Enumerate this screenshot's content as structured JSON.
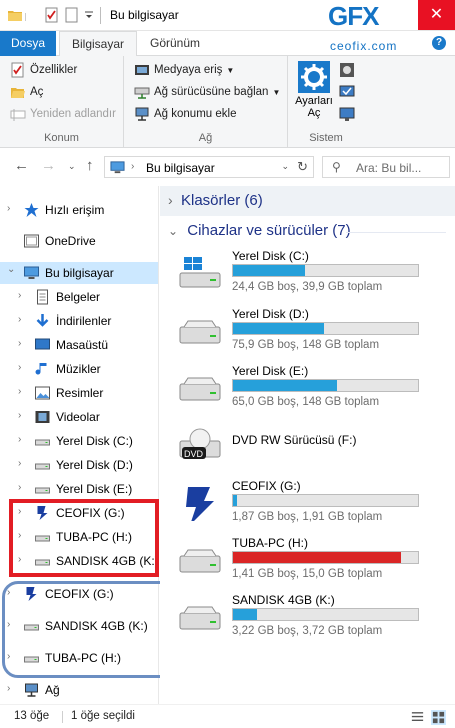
{
  "window": {
    "title": "Bu bilgisayar",
    "logo_text": "GFX",
    "close_glyph": "✕"
  },
  "ribbon": {
    "tabs": [
      {
        "label": "Dosya"
      },
      {
        "label": "Bilgisayar"
      },
      {
        "label": "Görünüm"
      }
    ],
    "watermark": "ceofix.com",
    "help": "?",
    "groups": {
      "konum": {
        "label": "Konum",
        "items": [
          "Özellikler",
          "Aç",
          "Yeniden adlandır"
        ]
      },
      "ag": {
        "label": "Ağ",
        "items": [
          "Medyaya eriş",
          "Ağ sürücüsüne bağlan",
          "Ağ konumu ekle"
        ]
      },
      "sistem": {
        "label": "Sistem",
        "open_settings": "Ayarları Aç"
      }
    }
  },
  "address": {
    "location": "Bu bilgisayar",
    "search_placeholder": "Ara: Bu bil..."
  },
  "nav": {
    "items": [
      {
        "label": "Hızlı erişim",
        "icon": "star-icon"
      },
      {
        "label": "OneDrive",
        "icon": "onedrive-icon"
      },
      {
        "label": "Bu bilgisayar",
        "icon": "computer-icon"
      },
      {
        "label": "Belgeler",
        "icon": "documents-icon"
      },
      {
        "label": "İndirilenler",
        "icon": "downloads-icon"
      },
      {
        "label": "Masaüstü",
        "icon": "desktop-icon"
      },
      {
        "label": "Müzikler",
        "icon": "music-icon"
      },
      {
        "label": "Resimler",
        "icon": "pictures-icon"
      },
      {
        "label": "Videolar",
        "icon": "videos-icon"
      },
      {
        "label": "Yerel Disk (C:)",
        "icon": "drive-icon"
      },
      {
        "label": "Yerel Disk (D:)",
        "icon": "drive-icon"
      },
      {
        "label": "Yerel Disk (E:)",
        "icon": "drive-icon"
      },
      {
        "label": "CEOFIX (G:)",
        "icon": "custom-drive-icon"
      },
      {
        "label": "TUBA-PC (H:)",
        "icon": "drive-icon"
      },
      {
        "label": "SANDISK 4GB (K:)",
        "icon": "drive-icon"
      },
      {
        "label": "CEOFIX (G:)",
        "icon": "custom-drive-icon"
      },
      {
        "label": "SANDISK 4GB (K:)",
        "icon": "drive-icon"
      },
      {
        "label": "TUBA-PC (H:)",
        "icon": "drive-icon"
      },
      {
        "label": "Ağ",
        "icon": "network-icon"
      }
    ]
  },
  "content": {
    "folders_header": "Klasörler (6)",
    "devices_header": "Cihazlar ve sürücüler (7)",
    "drives": [
      {
        "name": "Yerel Disk (C:)",
        "info": "24,4 GB boş, 39,9 GB toplam",
        "used_fraction": 0.39,
        "icon": "windows-drive-icon"
      },
      {
        "name": "Yerel Disk (D:)",
        "info": "75,9 GB boş, 148 GB toplam",
        "used_fraction": 0.49,
        "icon": "drive-icon"
      },
      {
        "name": "Yerel Disk (E:)",
        "info": "65,0 GB boş, 148 GB toplam",
        "used_fraction": 0.56,
        "icon": "drive-icon"
      },
      {
        "name": "DVD RW Sürücüsü (F:)",
        "info": "",
        "used_fraction": null,
        "icon": "dvd-drive-icon",
        "icon_text": "DVD"
      },
      {
        "name": "CEOFIX (G:)",
        "info": "1,87 GB boş, 1,91 GB toplam",
        "used_fraction": 0.02,
        "icon": "custom-drive-icon"
      },
      {
        "name": "TUBA-PC (H:)",
        "info": "1,41 GB boş, 15,0 GB toplam",
        "used_fraction": 0.91,
        "icon": "drive-icon"
      },
      {
        "name": "SANDISK 4GB (K:)",
        "info": "3,22 GB boş, 3,72 GB toplam",
        "used_fraction": 0.13,
        "icon": "drive-icon"
      }
    ]
  },
  "status": {
    "count": "13 öğe",
    "selected": "1 öğe seçildi"
  },
  "colors": {
    "accent": "#1979ca",
    "bar_normal": "#26a0da",
    "bar_full": "#da2626",
    "highlight_red": "#e21d24",
    "highlight_blue": "#6b8ec2"
  }
}
